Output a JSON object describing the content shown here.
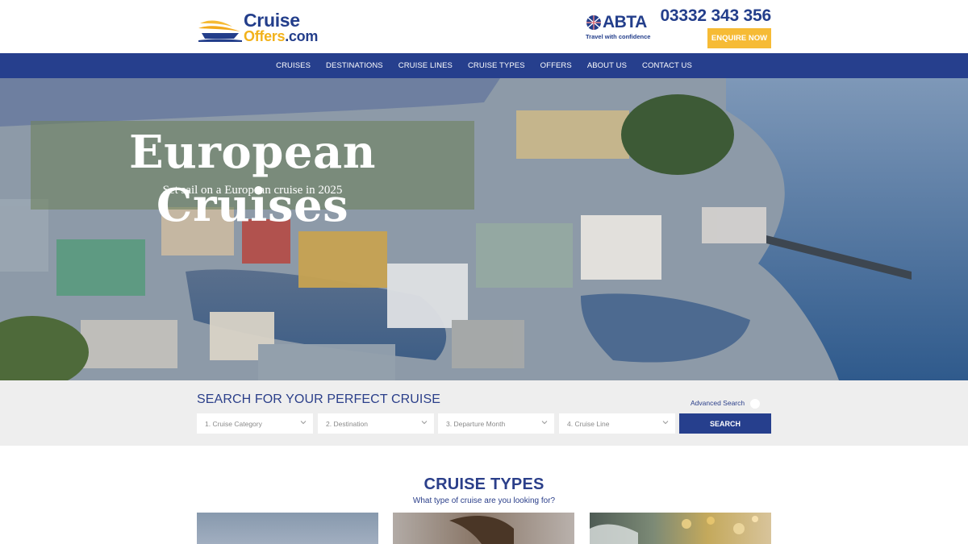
{
  "header": {
    "logo": {
      "line1": "Cruise",
      "line2_accent": "Offers",
      "line2_suffix": ".com"
    },
    "abta": {
      "name": "ABTA",
      "tagline": "Travel with confidence"
    },
    "phone": "03332 343 356",
    "enquire_label": "ENQUIRE NOW"
  },
  "nav": {
    "items": [
      {
        "label": "CRUISES"
      },
      {
        "label": "DESTINATIONS"
      },
      {
        "label": "CRUISE LINES"
      },
      {
        "label": "CRUISE TYPES"
      },
      {
        "label": "OFFERS"
      },
      {
        "label": "ABOUT US"
      },
      {
        "label": "CONTACT US"
      }
    ]
  },
  "hero": {
    "title": "European Cruises",
    "subtitle": "Set sail on a European cruise in 2025"
  },
  "search": {
    "title": "SEARCH FOR YOUR PERFECT CRUISE",
    "advanced_label": "Advanced Search",
    "advanced_enabled": false,
    "selects": [
      {
        "label": "1. Cruise Category"
      },
      {
        "label": "2. Destination"
      },
      {
        "label": "3. Departure Month"
      },
      {
        "label": "4. Cruise Line"
      }
    ],
    "button_label": "SEARCH"
  },
  "cruise_types": {
    "title": "CRUISE TYPES",
    "subtitle": "What type of cruise are you looking for?"
  },
  "colors": {
    "brand_blue": "#263f8d",
    "accent_yellow": "#f6bb35",
    "search_bg": "#eeeeee"
  }
}
